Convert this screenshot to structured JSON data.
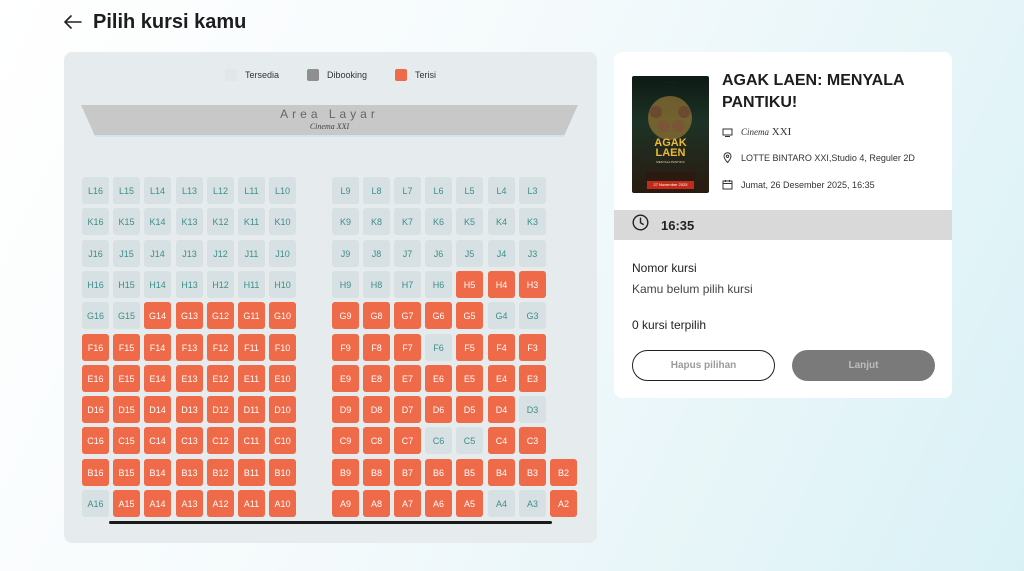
{
  "header": {
    "title": "Pilih kursi kamu",
    "back_icon": "arrow-left-icon"
  },
  "legend": [
    {
      "label": "Tersedia",
      "color": "#e2e6e8"
    },
    {
      "label": "Dibooking",
      "color": "#8f8f8f"
    },
    {
      "label": "Terisi",
      "color": "#ee6a48"
    }
  ],
  "screen": {
    "label": "Area Layar",
    "cinema_prefix": "Cinema",
    "cinema_suffix": "XXI"
  },
  "colors": {
    "available_bg": "#d7e0e2",
    "available_text": "#3e8f8a",
    "taken": "#ee6a48",
    "booked": "#8f8f8f"
  },
  "seats": {
    "rows": [
      "L",
      "K",
      "J",
      "H",
      "G",
      "F",
      "E",
      "D",
      "C",
      "B",
      "A"
    ],
    "left_block": [
      16,
      15,
      14,
      13,
      12,
      11,
      10
    ],
    "right_block": [
      9,
      8,
      7,
      6,
      5,
      4,
      3
    ],
    "extra_seats": [
      "B2",
      "A2"
    ],
    "taken": [
      "H5",
      "H4",
      "H3",
      "G14",
      "G13",
      "G12",
      "G11",
      "G10",
      "G9",
      "G8",
      "G7",
      "G6",
      "G5",
      "F16",
      "F15",
      "F14",
      "F13",
      "F12",
      "F11",
      "F10",
      "F9",
      "F8",
      "F7",
      "F5",
      "F4",
      "F3",
      "E16",
      "E15",
      "E14",
      "E13",
      "E12",
      "E11",
      "E10",
      "E9",
      "E8",
      "E7",
      "E6",
      "E5",
      "E4",
      "E3",
      "D16",
      "D15",
      "D14",
      "D13",
      "D12",
      "D11",
      "D10",
      "D9",
      "D8",
      "D7",
      "D6",
      "D5",
      "D4",
      "C16",
      "C15",
      "C14",
      "C13",
      "C12",
      "C11",
      "C10",
      "C9",
      "C8",
      "C7",
      "C4",
      "C3",
      "B16",
      "B15",
      "B14",
      "B13",
      "B12",
      "B11",
      "B10",
      "B9",
      "B8",
      "B7",
      "B6",
      "B5",
      "B4",
      "B3",
      "B2",
      "A15",
      "A14",
      "A13",
      "A12",
      "A11",
      "A10",
      "A9",
      "A8",
      "A7",
      "A6",
      "A5",
      "A2"
    ],
    "booked": []
  },
  "movie": {
    "title": "AGAK LAEN: MENYALA PANTIKU!",
    "cinema_prefix": "Cinema",
    "cinema_suffix": "XXI",
    "location": "LOTTE BINTARO XXI,Studio 4, Reguler 2D",
    "datetime": "Jumat, 26 Desember 2025, 16:35",
    "poster": {
      "title_line1": "AGAK",
      "title_line2": "LAEN",
      "subtitle": "MENYALA PANTIKU!",
      "date_badge": "27 November 2025"
    }
  },
  "showtime": "16:35",
  "selection": {
    "label": "Nomor kursi",
    "empty_text": "Kamu belum pilih kursi",
    "count_text": "0 kursi terpilih"
  },
  "buttons": {
    "clear": "Hapus pilihan",
    "next": "Lanjut"
  }
}
